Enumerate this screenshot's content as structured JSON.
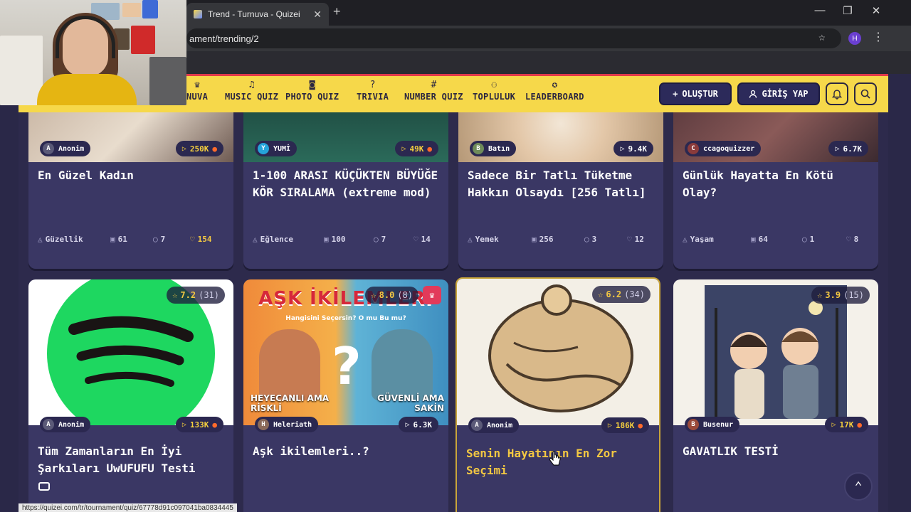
{
  "browser": {
    "tab_title": "Trend - Turnuva - Quizei",
    "tab_close": "✕",
    "new_tab": "+",
    "url": "ament/trending/2",
    "profile_initial": "H",
    "status_url": "https://quizei.com/tr/tournament/quiz/67778d91c097041ba0834445"
  },
  "nav": {
    "items": [
      {
        "label": "NUVA",
        "icon": "trophy-icon"
      },
      {
        "label": "MUSIC QUIZ",
        "icon": "music-note-icon"
      },
      {
        "label": "PHOTO QUIZ",
        "icon": "camera-icon"
      },
      {
        "label": "TRIVIA",
        "icon": "question-icon"
      },
      {
        "label": "NUMBER QUIZ",
        "icon": "hash-icon"
      },
      {
        "label": "TOPLULUK",
        "icon": "users-icon"
      },
      {
        "label": "LEADERBOARD",
        "icon": "medal-icon"
      }
    ],
    "create_label": "OLUŞTUR",
    "login_label": "GİRİŞ YAP"
  },
  "cards_row1": [
    {
      "author": "Anonim",
      "avatar": "A",
      "plays": "250K",
      "hot": true,
      "plays_gold": true,
      "title": "En Güzel Kadın",
      "category": "Güzellik",
      "items": "61",
      "comments": "7",
      "likes": "154",
      "likes_gold": true
    },
    {
      "author": "YUMİ",
      "avatar": "Y",
      "plays": "49K",
      "hot": true,
      "plays_gold": true,
      "title": "1-100 ARASI KÜÇÜKTEN BÜYÜĞE KÖR SIRALAMA (extreme mod)",
      "category": "Eğlence",
      "items": "100",
      "comments": "7",
      "likes": "14",
      "likes_gold": false
    },
    {
      "author": "Batın",
      "avatar": "B",
      "plays": "9.4K",
      "hot": false,
      "plays_gold": false,
      "title": "Sadece Bir Tatlı Tüketme Hakkın Olsaydı [256 Tatlı]",
      "category": "Yemek",
      "items": "256",
      "comments": "3",
      "likes": "12",
      "likes_gold": false
    },
    {
      "author": "ccagoquizzer",
      "avatar": "C",
      "plays": "6.7K",
      "hot": false,
      "plays_gold": false,
      "title": "Günlük Hayatta En Kötü Olay?",
      "category": "Yaşam",
      "items": "64",
      "comments": "1",
      "likes": "8",
      "likes_gold": false
    }
  ],
  "cards_row2": [
    {
      "author": "Anonim",
      "avatar": "A",
      "plays": "133K",
      "hot": true,
      "plays_gold": true,
      "rating": "7.2",
      "rating_count": "(31)",
      "title": "Tüm Zamanların En İyi Şarkıları UwUFUFU Testi"
    },
    {
      "author": "Heleriath",
      "avatar": "H",
      "plays": "6.3K",
      "hot": false,
      "plays_gold": false,
      "rating": "8.0",
      "rating_count": "(8)",
      "title": "Aşk ikilemleri..?",
      "thumb_text_top": "AŞK İKİLEMLERİ",
      "thumb_sub": "Hangisini Seçersin? O mu Bu mu?",
      "thumb_left": "HEYECANLI AMA RİSKLİ",
      "thumb_right": "GÜVENLİ AMA SAKİN"
    },
    {
      "author": "Anonim",
      "avatar": "A",
      "plays": "186K",
      "hot": true,
      "plays_gold": true,
      "rating": "6.2",
      "rating_count": "(34)",
      "title": "Senin Hayatının En Zor Seçimi"
    },
    {
      "author": "Busenur",
      "avatar": "B",
      "plays": "17K",
      "hot": true,
      "plays_gold": true,
      "rating": "3.9",
      "rating_count": "(15)",
      "title": "GAVATLIK TESTİ"
    }
  ],
  "colors": {
    "nav_bg": "#f6d84a",
    "accent_gold": "#f3c842",
    "card_bg": "#3a3764",
    "spotify_green": "#1ed760"
  }
}
